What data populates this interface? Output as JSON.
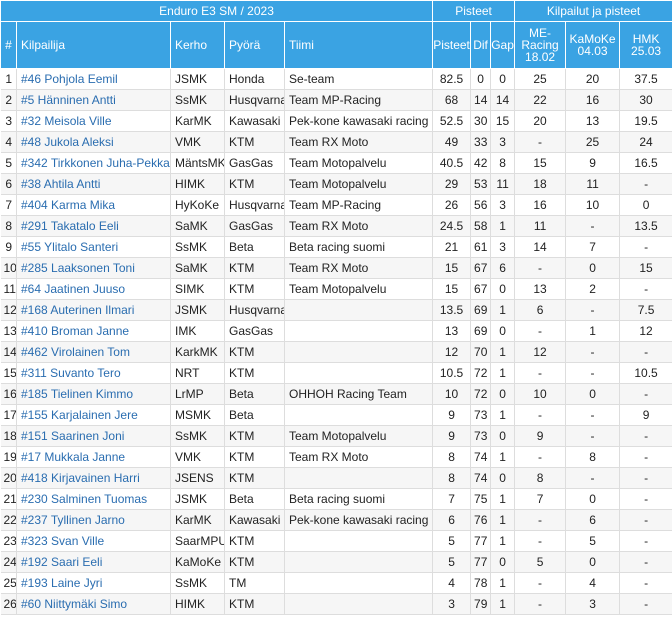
{
  "header": {
    "title": "Enduro E3 SM / 2023",
    "group_points": "Pisteet",
    "group_races": "Kilpailut ja pisteet"
  },
  "columns": {
    "rank": "#",
    "rider": "Kilpailija",
    "club": "Kerho",
    "bike": "Pyörä",
    "team": "Tiimi",
    "points": "Pisteet",
    "dif": "Dif",
    "gap": "Gap",
    "race1": "ME-Racing 18.02",
    "race2": "KaMoKe 04.03",
    "race3": "HMK 25.03"
  },
  "rows": [
    {
      "rank": "1",
      "rider": "#46 Pohjola Eemil",
      "club": "JSMK",
      "bike": "Honda",
      "team": "Se-team",
      "points": "82.5",
      "dif": "0",
      "gap": "0",
      "r1": "25",
      "r2": "20",
      "r3": "37.5"
    },
    {
      "rank": "2",
      "rider": "#5 Hänninen Antti",
      "club": "SsMK",
      "bike": "Husqvarna",
      "team": "Team MP-Racing",
      "points": "68",
      "dif": "14",
      "gap": "14",
      "r1": "22",
      "r2": "16",
      "r3": "30"
    },
    {
      "rank": "3",
      "rider": "#32 Meisola Ville",
      "club": "KarMK",
      "bike": "Kawasaki",
      "team": "Pek-kone kawasaki racing",
      "points": "52.5",
      "dif": "30",
      "gap": "15",
      "r1": "20",
      "r2": "13",
      "r3": "19.5"
    },
    {
      "rank": "4",
      "rider": "#48 Jukola Aleksi",
      "club": "VMK",
      "bike": "KTM",
      "team": "Team RX Moto",
      "points": "49",
      "dif": "33",
      "gap": "3",
      "r1": "-",
      "r2": "25",
      "r3": "24"
    },
    {
      "rank": "5",
      "rider": "#342 Tirkkonen Juha-Pekka",
      "club": "MäntsMK",
      "bike": "GasGas",
      "team": "Team Motopalvelu",
      "points": "40.5",
      "dif": "42",
      "gap": "8",
      "r1": "15",
      "r2": "9",
      "r3": "16.5"
    },
    {
      "rank": "6",
      "rider": "#38 Ahtila Antti",
      "club": "HIMK",
      "bike": "KTM",
      "team": "Team Motopalvelu",
      "points": "29",
      "dif": "53",
      "gap": "11",
      "r1": "18",
      "r2": "11",
      "r3": "-"
    },
    {
      "rank": "7",
      "rider": "#404 Karma Mika",
      "club": "HyKoKe",
      "bike": "Husqvarna",
      "team": "Team MP-Racing",
      "points": "26",
      "dif": "56",
      "gap": "3",
      "r1": "16",
      "r2": "10",
      "r3": "0"
    },
    {
      "rank": "8",
      "rider": "#291 Takatalo Eeli",
      "club": "SaMK",
      "bike": "GasGas",
      "team": "Team RX Moto",
      "points": "24.5",
      "dif": "58",
      "gap": "1",
      "r1": "11",
      "r2": "-",
      "r3": "13.5"
    },
    {
      "rank": "9",
      "rider": "#55 Ylitalo Santeri",
      "club": "SsMK",
      "bike": "Beta",
      "team": "Beta racing suomi",
      "points": "21",
      "dif": "61",
      "gap": "3",
      "r1": "14",
      "r2": "7",
      "r3": "-"
    },
    {
      "rank": "10",
      "rider": "#285 Laaksonen Toni",
      "club": "SaMK",
      "bike": "KTM",
      "team": "Team RX Moto",
      "points": "15",
      "dif": "67",
      "gap": "6",
      "r1": "-",
      "r2": "0",
      "r3": "15"
    },
    {
      "rank": "11",
      "rider": "#64 Jaatinen Juuso",
      "club": "SIMK",
      "bike": "KTM",
      "team": "Team Motopalvelu",
      "points": "15",
      "dif": "67",
      "gap": "0",
      "r1": "13",
      "r2": "2",
      "r3": "-"
    },
    {
      "rank": "12",
      "rider": "#168 Auterinen Ilmari",
      "club": "JSMK",
      "bike": "Husqvarna",
      "team": "",
      "points": "13.5",
      "dif": "69",
      "gap": "1",
      "r1": "6",
      "r2": "-",
      "r3": "7.5"
    },
    {
      "rank": "13",
      "rider": "#410 Broman Janne",
      "club": "IMK",
      "bike": "GasGas",
      "team": "",
      "points": "13",
      "dif": "69",
      "gap": "0",
      "r1": "-",
      "r2": "1",
      "r3": "12"
    },
    {
      "rank": "14",
      "rider": "#462 Virolainen Tom",
      "club": "KarkMK",
      "bike": "KTM",
      "team": "",
      "points": "12",
      "dif": "70",
      "gap": "1",
      "r1": "12",
      "r2": "-",
      "r3": "-"
    },
    {
      "rank": "15",
      "rider": "#311 Suvanto Tero",
      "club": "NRT",
      "bike": "KTM",
      "team": "",
      "points": "10.5",
      "dif": "72",
      "gap": "1",
      "r1": "-",
      "r2": "-",
      "r3": "10.5"
    },
    {
      "rank": "16",
      "rider": "#185 Tielinen Kimmo",
      "club": "LrMP",
      "bike": "Beta",
      "team": "OHHOH Racing Team",
      "points": "10",
      "dif": "72",
      "gap": "0",
      "r1": "10",
      "r2": "0",
      "r3": "-"
    },
    {
      "rank": "17",
      "rider": "#155 Karjalainen Jere",
      "club": "MSMK",
      "bike": "Beta",
      "team": "",
      "points": "9",
      "dif": "73",
      "gap": "1",
      "r1": "-",
      "r2": "-",
      "r3": "9"
    },
    {
      "rank": "18",
      "rider": "#151 Saarinen Joni",
      "club": "SsMK",
      "bike": "KTM",
      "team": "Team Motopalvelu",
      "points": "9",
      "dif": "73",
      "gap": "0",
      "r1": "9",
      "r2": "-",
      "r3": "-"
    },
    {
      "rank": "19",
      "rider": "#17 Mukkala Janne",
      "club": "VMK",
      "bike": "KTM",
      "team": "Team RX Moto",
      "points": "8",
      "dif": "74",
      "gap": "1",
      "r1": "-",
      "r2": "8",
      "r3": "-"
    },
    {
      "rank": "20",
      "rider": "#418 Kirjavainen Harri",
      "club": "JSENS",
      "bike": "KTM",
      "team": "",
      "points": "8",
      "dif": "74",
      "gap": "0",
      "r1": "8",
      "r2": "-",
      "r3": "-"
    },
    {
      "rank": "21",
      "rider": "#230 Salminen Tuomas",
      "club": "JSMK",
      "bike": "Beta",
      "team": "Beta racing suomi",
      "points": "7",
      "dif": "75",
      "gap": "1",
      "r1": "7",
      "r2": "0",
      "r3": "-"
    },
    {
      "rank": "22",
      "rider": "#237 Tyllinen Jarno",
      "club": "KarMK",
      "bike": "Kawasaki",
      "team": "Pek-kone kawasaki racing",
      "points": "6",
      "dif": "76",
      "gap": "1",
      "r1": "-",
      "r2": "6",
      "r3": "-"
    },
    {
      "rank": "23",
      "rider": "#323 Svan Ville",
      "club": "SaarMPU",
      "bike": "KTM",
      "team": "",
      "points": "5",
      "dif": "77",
      "gap": "1",
      "r1": "-",
      "r2": "5",
      "r3": "-"
    },
    {
      "rank": "24",
      "rider": "#192 Saari Eeli",
      "club": "KaMoKe",
      "bike": "KTM",
      "team": "",
      "points": "5",
      "dif": "77",
      "gap": "0",
      "r1": "5",
      "r2": "0",
      "r3": "-"
    },
    {
      "rank": "25",
      "rider": "#193 Laine Jyri",
      "club": "SsMK",
      "bike": "TM",
      "team": "",
      "points": "4",
      "dif": "78",
      "gap": "1",
      "r1": "-",
      "r2": "4",
      "r3": "-"
    },
    {
      "rank": "26",
      "rider": "#60 Niittymäki Simo",
      "club": "HIMK",
      "bike": "KTM",
      "team": "",
      "points": "3",
      "dif": "79",
      "gap": "1",
      "r1": "-",
      "r2": "3",
      "r3": "-"
    }
  ]
}
